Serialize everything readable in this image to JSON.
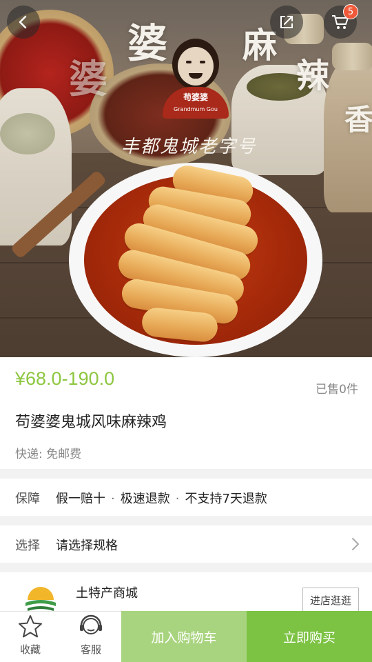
{
  "hero": {
    "calligraphy": [
      "婆",
      "麻",
      "辣",
      "香",
      "婆"
    ],
    "tagline": "丰都鬼城老字号",
    "brand_name": "苟婆婆",
    "brand_en": "Grandmum Gou"
  },
  "header": {
    "cart_count": "5"
  },
  "product": {
    "price": "¥68.0-190.0",
    "sold": "已售0件",
    "title": "苟婆婆鬼城风味麻辣鸡",
    "shipping": "快递: 免邮费"
  },
  "guarantee": {
    "label": "保障",
    "items": [
      "假一赔十",
      "极速退款",
      "不支持7天退款"
    ],
    "separator": "·"
  },
  "spec": {
    "label": "选择",
    "value": "请选择规格"
  },
  "store": {
    "name": "土特产商城",
    "visit_label": "进店逛逛"
  },
  "bottom_bar": {
    "favorite_label": "收藏",
    "service_label": "客服",
    "add_cart_label": "加入购物车",
    "buy_now_label": "立即购买"
  },
  "colors": {
    "accent": "#8dc63f",
    "buy_now": "#7cc243",
    "add_cart": "#a9d47f",
    "badge": "#f05a3a"
  },
  "icons": {
    "back": "chevron-left-icon",
    "share": "share-icon",
    "cart": "cart-icon",
    "favorite": "star-icon",
    "service": "headset-icon",
    "chevron": "chevron-right-icon"
  }
}
